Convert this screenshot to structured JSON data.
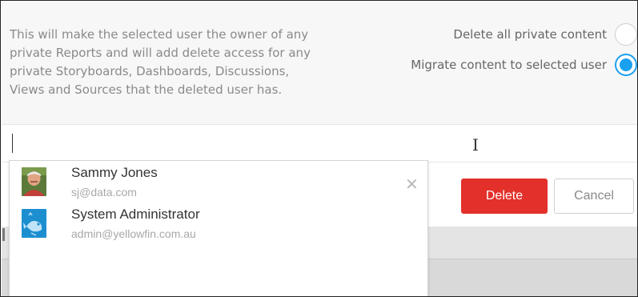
{
  "info": {
    "message_lines": [
      "This will make the selected user the owner of any",
      "private Reports and will add delete access for any",
      "private Storyboards, Dashboards, Discussions,",
      "Views and Sources that the deleted user has."
    ]
  },
  "options": {
    "delete_all_label": "Delete all private content",
    "migrate_label": "Migrate content to selected user",
    "selected": "migrate"
  },
  "search": {
    "value": ""
  },
  "users": [
    {
      "name": "Sammy Jones",
      "email": "sj@data.com",
      "avatar": "person-photo-avatar"
    },
    {
      "name": "System Administrator",
      "email": "admin@yellowfin.com.au",
      "avatar": "yellowfin-logo-avatar"
    }
  ],
  "actions": {
    "delete_label": "Delete",
    "cancel_label": "Cancel"
  },
  "icons": {
    "close": "close-icon"
  },
  "colors": {
    "accent": "#1aa0f0",
    "danger": "#e3302a"
  }
}
